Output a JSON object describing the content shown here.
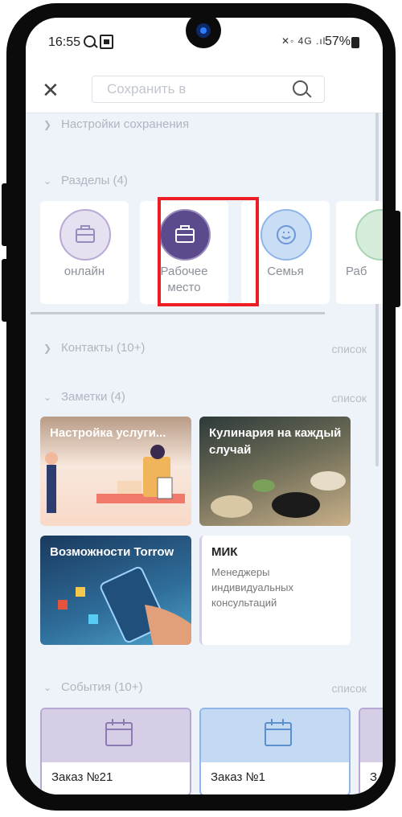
{
  "status_bar": {
    "time": "16:55",
    "network": "4G",
    "battery": "57%"
  },
  "toolbar": {
    "search_placeholder": "Сохранить в"
  },
  "sections": {
    "save_settings": "Настройки сохранения",
    "partitions": "Разделы (4)",
    "contacts": "Контакты (10+)",
    "notes": "Заметки (4)",
    "events": "События (10+)",
    "list_link": "список"
  },
  "partitions": [
    {
      "label": "онлайн",
      "color": "#b8a9d4"
    },
    {
      "label": "Рабочее место",
      "color": "#5b4a8c"
    },
    {
      "label": "Семья",
      "color": "#8fb6e8"
    },
    {
      "label": "Раб",
      "color": "#a7d6b4"
    }
  ],
  "notes": [
    {
      "title": "Настройка услуги...",
      "description": ""
    },
    {
      "title": "Кулинария на каждый случай",
      "description": ""
    },
    {
      "title": "Возможности Torrow",
      "description": ""
    },
    {
      "title": "МИК",
      "description": "Менеджеры индивидуальных консультаций"
    }
  ],
  "events": [
    {
      "title": "Заказ №21",
      "color": "#d6cde6"
    },
    {
      "title": "Заказ №1",
      "color": "#c4daf2"
    },
    {
      "title": "З",
      "color": "#d6cde6"
    }
  ]
}
